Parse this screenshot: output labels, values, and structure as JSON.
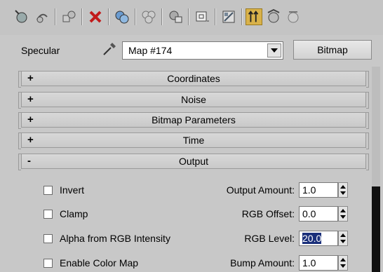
{
  "toolbar": {
    "icons": [
      "get-material-icon",
      "put-to-scene-icon",
      "assign-material-icon",
      "reset-map-icon",
      "copy-material-icon",
      "make-unique-icon",
      "put-to-library-icon",
      "material-id-channel-icon",
      "show-shaded-material-icon",
      "show-end-result-icon",
      "go-to-parent-icon",
      "go-forward-to-sibling-icon"
    ]
  },
  "specular": {
    "label": "Specular",
    "map_value": "Map #174",
    "type_button": "Bitmap"
  },
  "rollouts": [
    {
      "sign": "+",
      "title": "Coordinates"
    },
    {
      "sign": "+",
      "title": "Noise"
    },
    {
      "sign": "+",
      "title": "Bitmap Parameters"
    },
    {
      "sign": "+",
      "title": "Time"
    },
    {
      "sign": "-",
      "title": "Output"
    }
  ],
  "output": {
    "checkboxes": [
      {
        "label": "Invert",
        "checked": false
      },
      {
        "label": "Clamp",
        "checked": false
      },
      {
        "label": "Alpha from RGB Intensity",
        "checked": false
      },
      {
        "label": "Enable Color Map",
        "checked": false
      }
    ],
    "params": [
      {
        "label": "Output Amount:",
        "value": "1.0"
      },
      {
        "label": "RGB Offset:",
        "value": "0.0"
      },
      {
        "label": "RGB Level:",
        "value": "20.0"
      },
      {
        "label": "Bump Amount:",
        "value": "1.0"
      }
    ]
  },
  "colors": {
    "active_tool": "#d9b24a",
    "selection": "#1a2f7a"
  }
}
